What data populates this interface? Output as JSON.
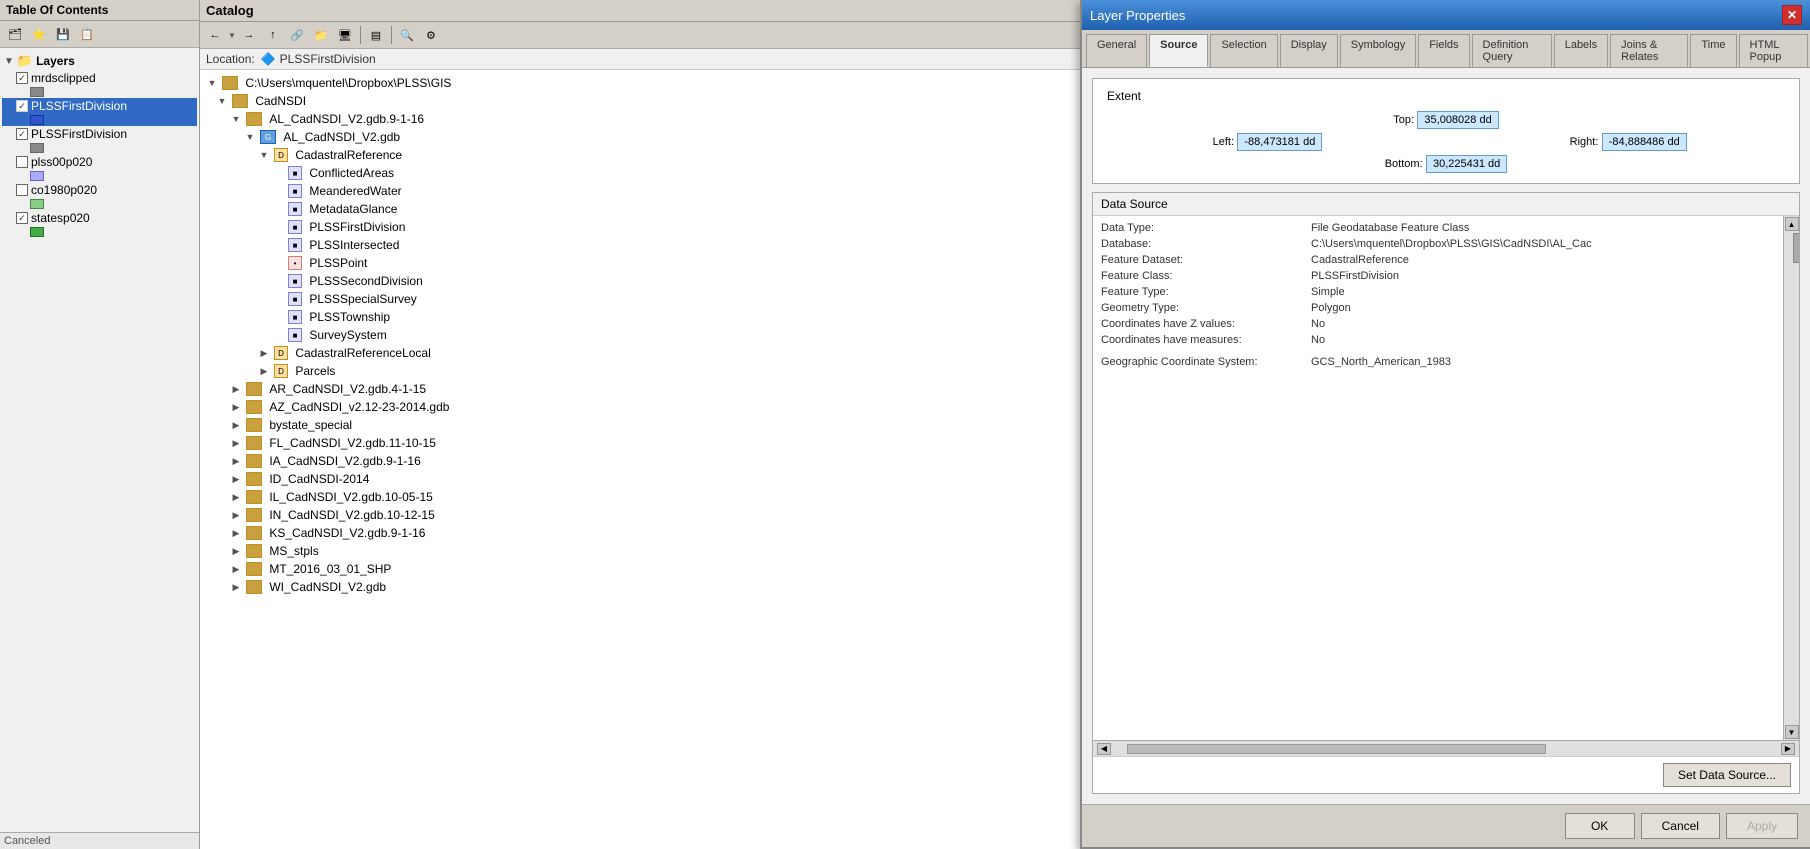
{
  "toc": {
    "title": "Table Of Contents",
    "layers_label": "Layers",
    "items": [
      {
        "id": "mrdsclipped",
        "label": "mrdsclipped",
        "checked": true,
        "indent": 1,
        "color": "#888888"
      },
      {
        "id": "PLSSFirstDivision_sel",
        "label": "PLSSFirstDivision",
        "checked": true,
        "indent": 1,
        "selected": true,
        "color": "#3355cc"
      },
      {
        "id": "PLSSFirstDivision2",
        "label": "PLSSFirstDivision",
        "checked": true,
        "indent": 1,
        "color": "#888888"
      },
      {
        "id": "plss00p020",
        "label": "plss00p020",
        "checked": false,
        "indent": 1,
        "color": "#aaaaff"
      },
      {
        "id": "co1980p020",
        "label": "co1980p020",
        "checked": false,
        "indent": 1,
        "color": "#88cc88"
      },
      {
        "id": "statesp020",
        "label": "statesp020",
        "checked": true,
        "indent": 1,
        "color": "#44aa44"
      }
    ],
    "footer": "Canceled"
  },
  "catalog": {
    "title": "Catalog",
    "location_label": "Location:",
    "location_value": "PLSSFirstDivision",
    "toolbar_buttons": [
      "←",
      "→",
      "↑",
      "⭐",
      "📁",
      "🖥",
      "▤",
      "▦",
      "⚡",
      "🔍"
    ],
    "tree": [
      {
        "label": "C:\\Users\\mquentel\\Dropbox\\PLSS\\GIS",
        "indent": 0,
        "type": "folder",
        "expanded": true
      },
      {
        "label": "CadNSDI",
        "indent": 1,
        "type": "folder",
        "expanded": true
      },
      {
        "label": "AL_CadNSDI_V2.gdb.9-1-16",
        "indent": 2,
        "type": "folder",
        "expanded": true
      },
      {
        "label": "AL_CadNSDI_V2.gdb",
        "indent": 3,
        "type": "gdb",
        "expanded": true
      },
      {
        "label": "CadastralReference",
        "indent": 4,
        "type": "dataset",
        "expanded": true
      },
      {
        "label": "ConflictedAreas",
        "indent": 5,
        "type": "feature"
      },
      {
        "label": "MeanderedWater",
        "indent": 5,
        "type": "feature"
      },
      {
        "label": "MetadataGlance",
        "indent": 5,
        "type": "feature"
      },
      {
        "label": "PLSSFirstDivision",
        "indent": 5,
        "type": "feature"
      },
      {
        "label": "PLSSIntersected",
        "indent": 5,
        "type": "feature"
      },
      {
        "label": "PLSSPoint",
        "indent": 5,
        "type": "feature"
      },
      {
        "label": "PLSSSecondDivision",
        "indent": 5,
        "type": "feature"
      },
      {
        "label": "PLSSSpecialSurvey",
        "indent": 5,
        "type": "feature"
      },
      {
        "label": "PLSSTownship",
        "indent": 5,
        "type": "feature"
      },
      {
        "label": "SurveySystem",
        "indent": 5,
        "type": "feature"
      },
      {
        "label": "CadastralReferenceLocal",
        "indent": 4,
        "type": "dataset",
        "expanded": false
      },
      {
        "label": "Parcels",
        "indent": 4,
        "type": "dataset",
        "expanded": false
      },
      {
        "label": "AR_CadNSDI_V2.gdb.4-1-15",
        "indent": 2,
        "type": "folder",
        "expanded": false
      },
      {
        "label": "AZ_CadNSDI_v2.12-23-2014.gdb",
        "indent": 2,
        "type": "folder",
        "expanded": false
      },
      {
        "label": "bystate_special",
        "indent": 2,
        "type": "folder",
        "expanded": false
      },
      {
        "label": "FL_CadNSDI_V2.gdb.11-10-15",
        "indent": 2,
        "type": "folder",
        "expanded": false
      },
      {
        "label": "IA_CadNSDI_V2.gdb.9-1-16",
        "indent": 2,
        "type": "folder",
        "expanded": false
      },
      {
        "label": "ID_CadNSDI-2014",
        "indent": 2,
        "type": "folder",
        "expanded": false
      },
      {
        "label": "IL_CadNSDI_V2.gdb.10-05-15",
        "indent": 2,
        "type": "folder",
        "expanded": false
      },
      {
        "label": "IN_CadNSDI_V2.gdb.10-12-15",
        "indent": 2,
        "type": "folder",
        "expanded": false
      },
      {
        "label": "KS_CadNSDI_V2.gdb.9-1-16",
        "indent": 2,
        "type": "folder",
        "expanded": false
      },
      {
        "label": "MS_stpls",
        "indent": 2,
        "type": "folder",
        "expanded": false
      },
      {
        "label": "MT_2016_03_01_SHP",
        "indent": 2,
        "type": "folder",
        "expanded": false
      },
      {
        "label": "WI_CadNSDI_V2.gdb",
        "indent": 2,
        "type": "folder",
        "expanded": false
      }
    ]
  },
  "layer_properties": {
    "title": "Layer Properties",
    "tabs": [
      "General",
      "Source",
      "Selection",
      "Display",
      "Symbology",
      "Fields",
      "Definition Query",
      "Labels",
      "Joins & Relates",
      "Time",
      "HTML Popup"
    ],
    "active_tab": "Source",
    "extent": {
      "label": "Extent",
      "top_label": "Top:",
      "top_value": "35,008028 dd",
      "left_label": "Left:",
      "left_value": "-88,473181 dd",
      "right_label": "Right:",
      "right_value": "-84,888486 dd",
      "bottom_label": "Bottom:",
      "bottom_value": "30,225431 dd"
    },
    "datasource": {
      "label": "Data Source",
      "rows": [
        {
          "key": "Data Type:",
          "value": "File Geodatabase Feature Class"
        },
        {
          "key": "Database:",
          "value": "C:\\Users\\mquentel\\Dropbox\\PLSS\\GIS\\CadNSDI\\AL_Cac"
        },
        {
          "key": "Feature Dataset:",
          "value": "CadastralReference"
        },
        {
          "key": "Feature Class:",
          "value": "PLSSFirstDivision"
        },
        {
          "key": "Feature Type:",
          "value": "Simple"
        },
        {
          "key": "Geometry Type:",
          "value": "Polygon"
        },
        {
          "key": "Coordinates have Z values:",
          "value": "No"
        },
        {
          "key": "Coordinates have measures:",
          "value": "No"
        },
        {
          "key": "Geographic Coordinate System:",
          "value": "GCS_North_American_1983"
        }
      ],
      "set_datasource_btn": "Set Data Source..."
    },
    "footer": {
      "ok_label": "OK",
      "cancel_label": "Cancel",
      "apply_label": "Apply"
    }
  }
}
